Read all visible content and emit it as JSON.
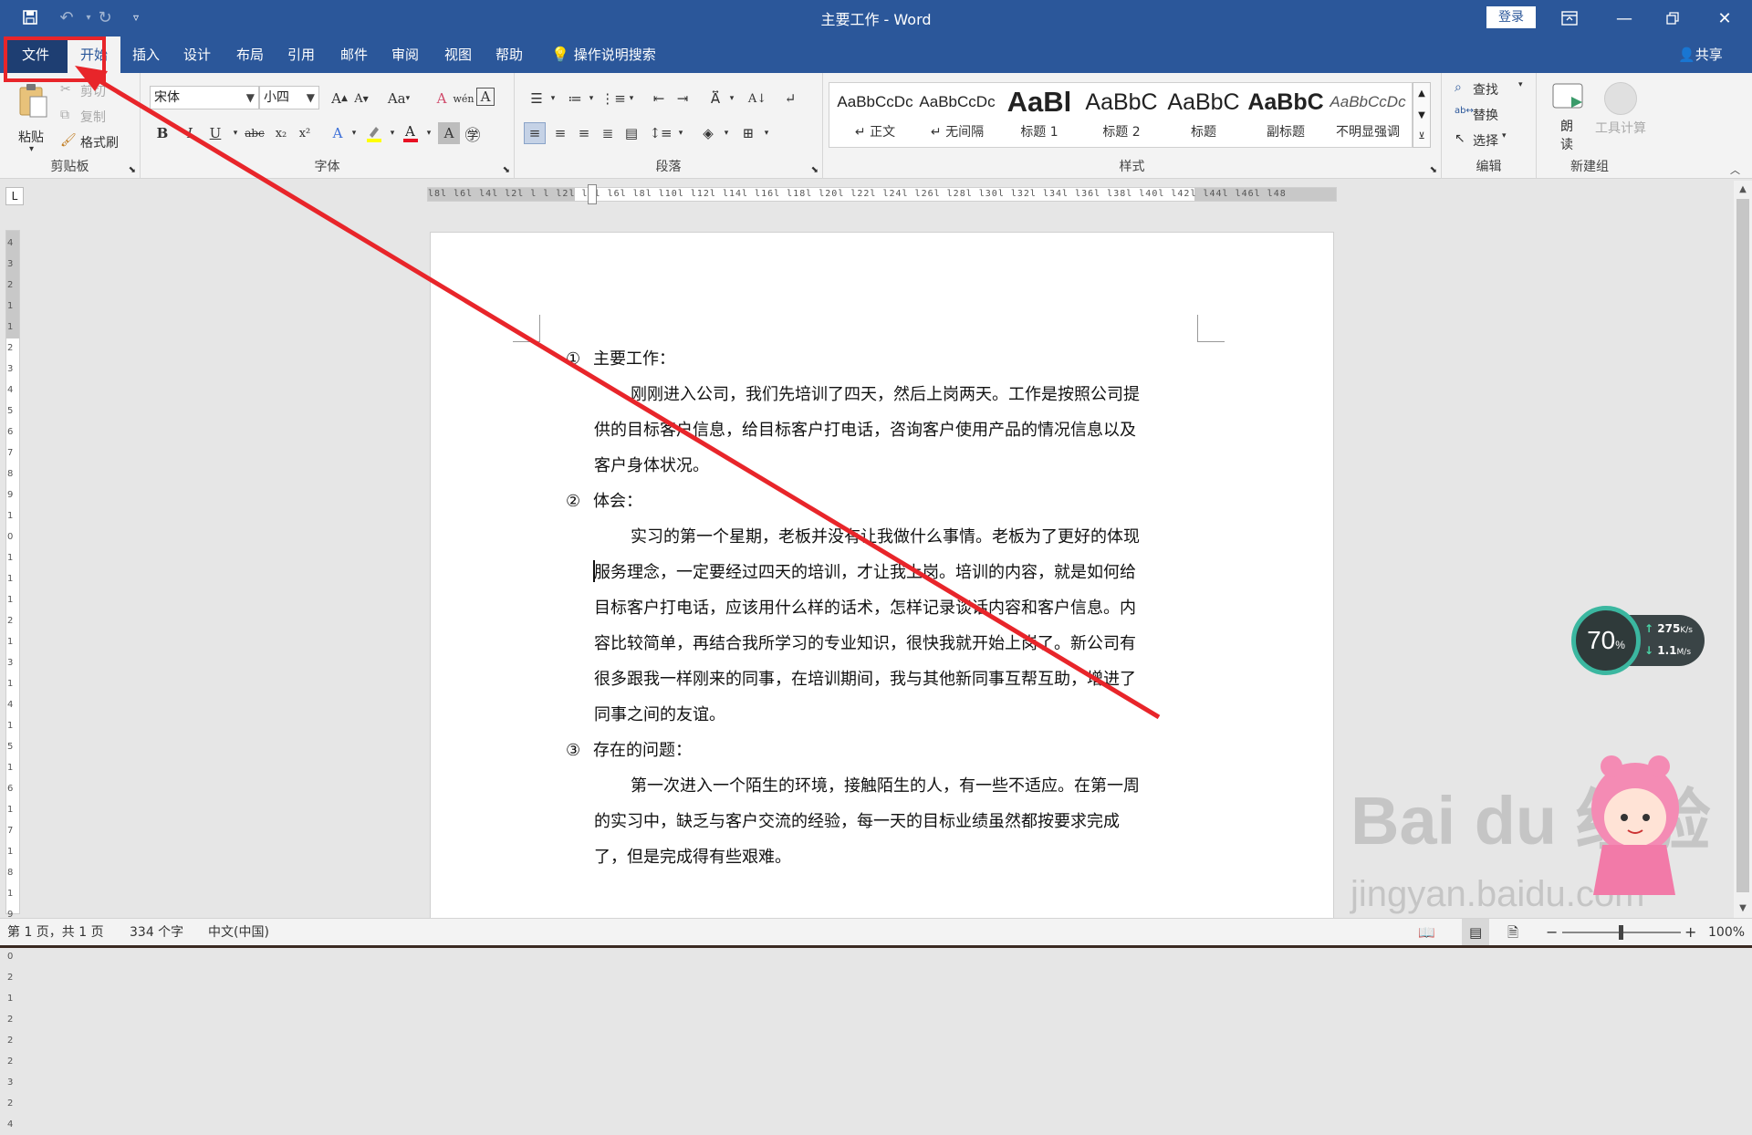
{
  "window": {
    "title": "主要工作  -  Word",
    "login_label": "登录"
  },
  "tabs": [
    {
      "label": "文件"
    },
    {
      "label": "开始"
    },
    {
      "label": "插入"
    },
    {
      "label": "设计"
    },
    {
      "label": "布局"
    },
    {
      "label": "引用"
    },
    {
      "label": "邮件"
    },
    {
      "label": "审阅"
    },
    {
      "label": "视图"
    },
    {
      "label": "帮助"
    }
  ],
  "tell_me": "操作说明搜索",
  "share": "共享",
  "clipboard": {
    "paste": "粘贴",
    "cut": "剪切",
    "copy": "复制",
    "format_painter": "格式刷",
    "group": "剪贴板"
  },
  "font": {
    "name": "宋体",
    "size": "小四",
    "change_case": "Aa",
    "bold": "B",
    "italic": "I",
    "underline": "U",
    "strike": "abc",
    "subscript": "x₂",
    "superscript": "x²",
    "group": "字体"
  },
  "paragraph": {
    "group": "段落"
  },
  "styles": {
    "items": [
      {
        "preview": "AaBbCcDc",
        "name": "↵ 正文"
      },
      {
        "preview": "AaBbCcDc",
        "name": "↵ 无间隔"
      },
      {
        "preview": "AaBl",
        "name": "标题 1"
      },
      {
        "preview": "AaBbC",
        "name": "标题 2"
      },
      {
        "preview": "AaBbC",
        "name": "标题"
      },
      {
        "preview": "AaBbC",
        "name": "副标题"
      },
      {
        "preview": "AaBbCcDc",
        "name": "不明显强调"
      }
    ],
    "group": "样式"
  },
  "editing": {
    "find": "查找",
    "replace": "替换",
    "select": "选择",
    "group": "编辑"
  },
  "newgroup": {
    "read_aloud_1": "朗",
    "read_aloud_2": "读",
    "calc": "工具计算",
    "group": "新建组"
  },
  "ruler": {
    "h_ticks": "l8l l6l l4l l2l l  l  l2l l4l l6l l8l l10l l12l l14l l16l l18l l20l l22l l24l l26l l28l l30l l32l l34l l36l l38l l40l l42l l44l l46l l48",
    "v_ticks": "4 3 2 1   1 2 3 4 5 6 7 8 9 10 11 12 13 14 15 16 17 18 19 20 21 22 23 24",
    "tab_stop": "L"
  },
  "document": {
    "sections": [
      {
        "num": "①",
        "heading": "主要工作：",
        "lines": [
          "刚刚进入公司，我们先培训了四天，然后上岗两天。工作是按照公司提",
          "供的目标客户信息，给目标客户打电话，咨询客户使用产品的情况信息以及",
          "客户身体状况。"
        ]
      },
      {
        "num": "②",
        "heading": "体会：",
        "lines": [
          "实习的第一个星期，老板并没有让我做什么事情。老板为了更好的体现",
          "服务理念，一定要经过四天的培训，才让我上岗。培训的内容，就是如何给",
          "目标客户打电话，应该用什么样的话术，怎样记录谈话内容和客户信息。内",
          "容比较简单，再结合我所学习的专业知识，很快我就开始上岗了。新公司有",
          "很多跟我一样刚来的同事，在培训期间，我与其他新同事互帮互助，增进了",
          "同事之间的友谊。"
        ]
      },
      {
        "num": "③",
        "heading": "存在的问题：",
        "lines": [
          "第一次进入一个陌生的环境，接触陌生的人，有一些不适应。在第一周",
          "的实习中，缺乏与客户交流的经验，每一天的目标业绩虽然都按要求完成",
          "了，但是完成得有些艰难。"
        ]
      }
    ]
  },
  "status": {
    "page": "第 1 页，共 1 页",
    "words": "334 个字",
    "language": "中文(中国)",
    "zoom": "100%",
    "zoom_minus": "−",
    "zoom_plus": "+"
  },
  "net_widget": {
    "percent": "70",
    "percent_unit": "%",
    "up": "275",
    "up_unit": "K/s",
    "down": "1.1",
    "down_unit": "M/s"
  },
  "watermark": {
    "brand": "Bai  du 经验",
    "url": "jingyan.baidu.com"
  },
  "colors": {
    "accent": "#2b579a",
    "annotation_red": "#e8252a",
    "font_color_red": "#e81123",
    "highlight_yellow": "#ffff00"
  }
}
